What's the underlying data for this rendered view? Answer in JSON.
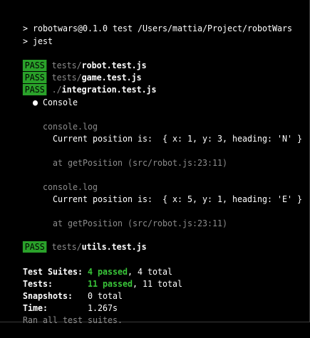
{
  "colors": {
    "background": "#000000",
    "pass_badge": "#2aa12a",
    "passed_text": "#39c539",
    "dim_text": "#8c8c8c"
  },
  "prompt": {
    "line1": "> robotwars@0.1.0 test /Users/mattia/Project/robotWars",
    "line2": "> jest"
  },
  "results": [
    {
      "badge": "PASS",
      "dir": "tests/",
      "file": "robot.test.js"
    },
    {
      "badge": "PASS",
      "dir": "tests/",
      "file": "game.test.js"
    },
    {
      "badge": "PASS",
      "dir": " ./",
      "file": "integration.test.js"
    }
  ],
  "console": {
    "header": "● Console",
    "logs": [
      {
        "label": "console.log",
        "message": "Current position is:  { x: 1, y: 3, heading: 'N' }",
        "location": "at getPosition (src/robot.js:23:11)"
      },
      {
        "label": "console.log",
        "message": "Current position is:  { x: 5, y: 1, heading: 'E' }",
        "location": "at getPosition (src/robot.js:23:11)"
      }
    ]
  },
  "last_result": {
    "badge": "PASS",
    "dir": "tests/",
    "file": "utils.test.js"
  },
  "summary": {
    "suites_label": "Test Suites: ",
    "suites_passed": "4 passed",
    "suites_total": ", 4 total",
    "tests_label": "Tests:       ",
    "tests_passed": "11 passed",
    "tests_total": ", 11 total",
    "snapshots_label": "Snapshots:   ",
    "snapshots_value": "0 total",
    "time_label": "Time:        ",
    "time_value": "1.267s",
    "footer": "Ran all test suites."
  }
}
